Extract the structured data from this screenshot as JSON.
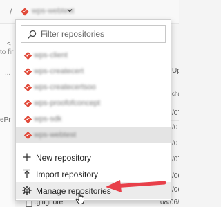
{
  "breadcrumb": {
    "separator": "/",
    "repo_name": "wps-webtest"
  },
  "background": {
    "left_text_1": "<",
    "left_text_2": "to fir",
    "left_dots": "...",
    "left_text_3": "ePr",
    "right_text_1": "Upl",
    "right_text_2": "cha",
    "right_dates": [
      "/07/",
      "/07/",
      "/07/",
      "/07/",
      "/06/",
      "/06/"
    ],
    "gitignore": {
      "name": ".gitignore",
      "date": "08/06/"
    }
  },
  "dropdown": {
    "search": {
      "placeholder": "Filter repositories",
      "value": ""
    },
    "repositories": [
      {
        "name": "wps-client",
        "selected": false
      },
      {
        "name": "wps-createcert",
        "selected": false
      },
      {
        "name": "wps-createcertsoo",
        "selected": false
      },
      {
        "name": "wps-proofofconcept",
        "selected": false
      },
      {
        "name": "wps-sdk",
        "selected": false
      },
      {
        "name": "wps-webtest",
        "selected": true
      }
    ],
    "actions": {
      "new_repository": "New repository",
      "import_repository": "Import repository",
      "manage_repositories": "Manage repositories"
    }
  },
  "colors": {
    "git_icon": "#e14a3a",
    "annotation_arrow": "#e8404a",
    "selected_row": "#e4e4e4"
  },
  "icons": {
    "repo": "git-diamond-icon",
    "search": "search-icon",
    "new": "plus-icon",
    "import": "import-icon",
    "manage": "gear-icon",
    "cursor": "hand-pointer-icon"
  }
}
